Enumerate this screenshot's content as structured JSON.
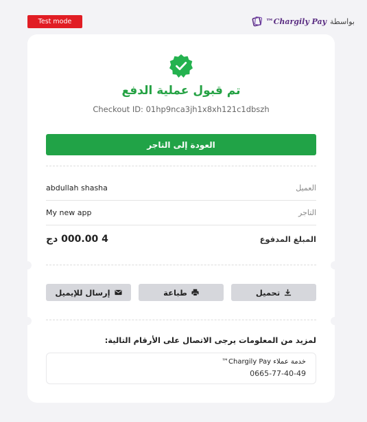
{
  "test_mode": "Test mode",
  "brand": {
    "by": "بواسطة",
    "name": "Chargily Pay™"
  },
  "success": {
    "title": "تم قبول عملية الدفع",
    "checkout_id": "Checkout ID: 01hp9nca3jh1x8xh121c1dbszh"
  },
  "back_button": "العودة إلى التاجر",
  "details": {
    "customer_label": "العميل",
    "customer_value": "abdullah shasha",
    "merchant_label": "التاجر",
    "merchant_value": "My new app",
    "amount_label": "المبلغ المدفوع",
    "amount_value": "4 000.00 دج"
  },
  "actions": {
    "email": "إرسال للإيميل",
    "print": "طباعة",
    "download": "تحميل"
  },
  "contact": {
    "heading": "لمزيد من المعلومات يرجى الاتصال على الأرقام التالية:",
    "title": "خدمة عملاء Chargily Pay™",
    "phone": "0665-77-40-49"
  },
  "colors": {
    "accent_green": "#21a347",
    "test_red": "#e11d24",
    "brand_purple": "#5a2d82"
  }
}
